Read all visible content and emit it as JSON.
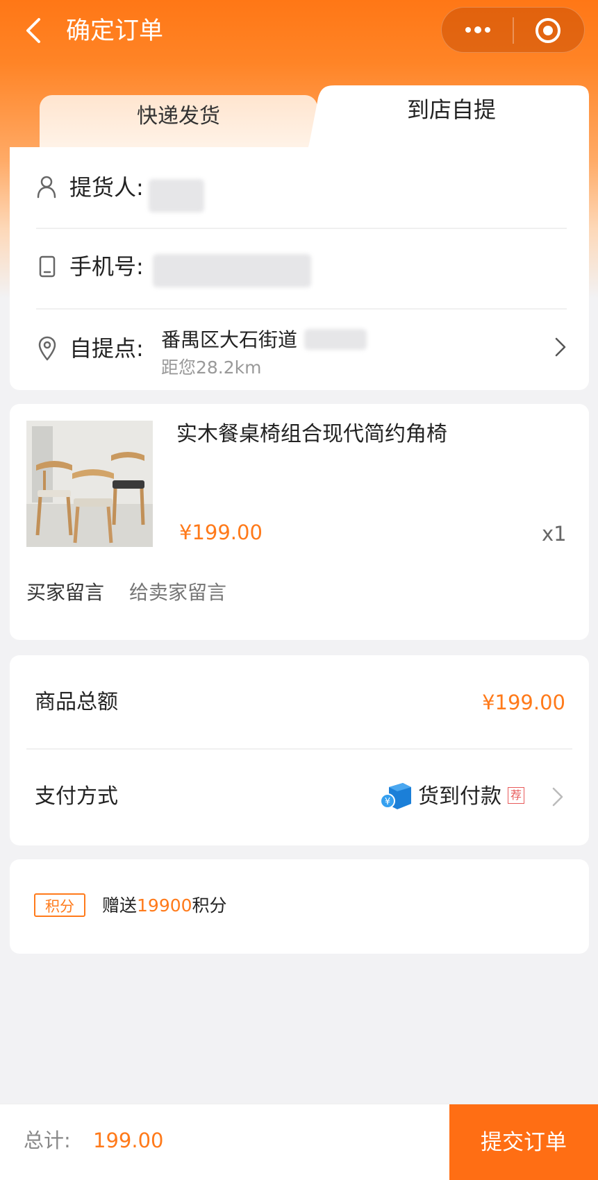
{
  "navbar": {
    "title": "确定订单"
  },
  "tabs": [
    {
      "label": "快递发货",
      "active": false
    },
    {
      "label": "到店自提",
      "active": true
    }
  ],
  "pickup": {
    "person_label": "提货人:",
    "phone_label": "手机号:",
    "location_label": "自提点:",
    "address": "番禺区大石街道",
    "distance": "距您28.2km"
  },
  "product": {
    "title": "实木餐桌椅组合现代简约角椅",
    "price": "¥199.00",
    "quantity": "x1",
    "message_label": "买家留言",
    "message_placeholder": "给卖家留言"
  },
  "summary": {
    "total_label": "商品总额",
    "total_value": "¥199.00",
    "payment_label": "支付方式",
    "payment_value": "货到付款",
    "recommend_badge": "荐"
  },
  "points": {
    "tag": "积分",
    "prefix": "赠送",
    "amount": "19900",
    "suffix": "积分"
  },
  "footer": {
    "total_label": "总计:",
    "total_value": "199.00",
    "submit_label": "提交订单"
  },
  "colors": {
    "accent": "#ff7a1a",
    "header": "#ff7716",
    "submit": "#ff6e14"
  }
}
